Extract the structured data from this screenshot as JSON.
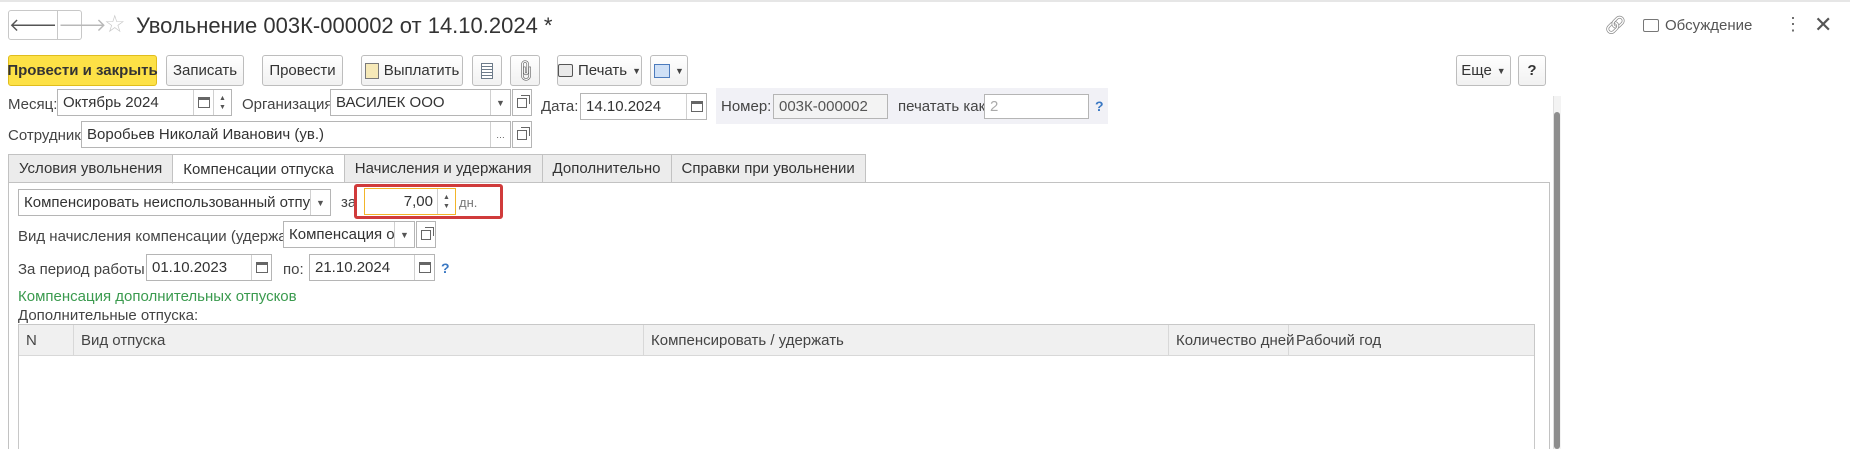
{
  "header": {
    "title": "Увольнение 003К-000002 от 14.10.2024 *",
    "back_glyph": "🡐",
    "forward_glyph": "🡒",
    "discuss_label": "Обсуждение"
  },
  "toolbar": {
    "post_close": "Провести и закрыть",
    "save": "Записать",
    "post": "Провести",
    "pay": "Выплатить",
    "print": "Печать",
    "more": "Еще",
    "help": "?"
  },
  "form": {
    "month_label": "Месяц:",
    "month_value": "Октябрь 2024",
    "org_label": "Организация:",
    "org_value": "ВАСИЛЕК ООО",
    "date_label": "Дата:",
    "date_value": "14.10.2024",
    "number_label": "Номер:",
    "number_value": "003К-000002",
    "print_as_label": "печатать как:",
    "print_as_placeholder": "2",
    "employee_label": "Сотрудник:",
    "employee_value": "Воробьев Николай Иванович (ув.)"
  },
  "tabs": [
    {
      "label": "Условия увольнения",
      "active": false
    },
    {
      "label": "Компенсации отпуска",
      "active": true
    },
    {
      "label": "Начисления и удержания",
      "active": false
    },
    {
      "label": "Дополнительно",
      "active": false
    },
    {
      "label": "Справки при увольнении",
      "active": false
    }
  ],
  "compensation": {
    "mode_value": "Компенсировать неиспользованный отпуск",
    "for_label": "за",
    "days_value": "7,00",
    "days_unit": "дн.",
    "accrual_label": "Вид начисления компенсации (удержания):",
    "accrual_value": "Компенсация отпуска",
    "period_from_label": "За период работы с:",
    "period_from_value": "01.10.2023",
    "period_to_label": "по:",
    "period_to_value": "21.10.2024",
    "extra_link": "Компенсация дополнительных отпусков",
    "extra_label": "Дополнительные отпуска:"
  },
  "table": {
    "columns": [
      "N",
      "Вид отпуска",
      "Компенсировать / удержать",
      "Количество дней",
      "Рабочий год"
    ]
  },
  "colors": {
    "primary_button": "#fde146",
    "highlight_border": "#d03b3b",
    "link_green": "#3a9a4e",
    "help_blue": "#3a78c3"
  }
}
